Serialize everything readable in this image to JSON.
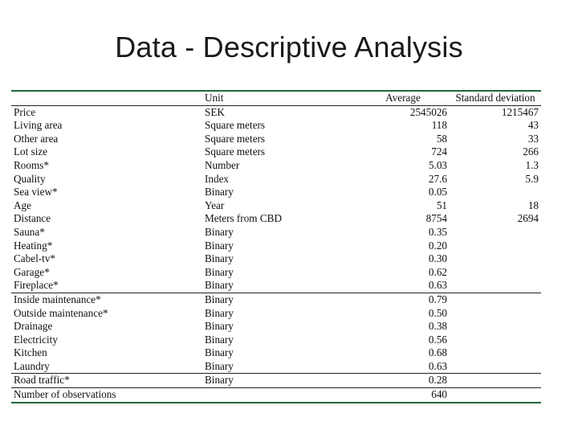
{
  "slide": {
    "title": "Data - Descriptive Analysis",
    "accent_color": "#1f6b3a",
    "text_color": "#111111"
  },
  "table": {
    "headers": {
      "variable": "",
      "unit": "Unit",
      "average": "Average",
      "std": "Standard deviation"
    },
    "rows": [
      {
        "variable": "Price",
        "unit": "SEK",
        "average": "2545026",
        "std": "1215467"
      },
      {
        "variable": "Living area",
        "unit": "Square meters",
        "average": "118",
        "std": "43"
      },
      {
        "variable": "Other area",
        "unit": "Square meters",
        "average": "58",
        "std": "33"
      },
      {
        "variable": "Lot size",
        "unit": "Square meters",
        "average": "724",
        "std": "266"
      },
      {
        "variable": "Rooms*",
        "unit": "Number",
        "average": "5.03",
        "std": "1.3"
      },
      {
        "variable": "Quality",
        "unit": "Index",
        "average": "27.6",
        "std": "5.9"
      },
      {
        "variable": "Sea view*",
        "unit": "Binary",
        "average": "0.05",
        "std": ""
      },
      {
        "variable": "Age",
        "unit": "Year",
        "average": "51",
        "std": "18"
      },
      {
        "variable": "Distance",
        "unit": "Meters from CBD",
        "average": "8754",
        "std": "2694"
      },
      {
        "variable": "Sauna*",
        "unit": "Binary",
        "average": "0.35",
        "std": ""
      },
      {
        "variable": "Heating*",
        "unit": "Binary",
        "average": "0.20",
        "std": ""
      },
      {
        "variable": "Cabel-tv*",
        "unit": "Binary",
        "average": "0.30",
        "std": ""
      },
      {
        "variable": "Garage*",
        "unit": "Binary",
        "average": "0.62",
        "std": ""
      },
      {
        "variable": "Fireplace*",
        "unit": "Binary",
        "average": "0.63",
        "std": ""
      },
      {
        "variable": "Inside maintenance*",
        "unit": "Binary",
        "average": "0.79",
        "std": ""
      },
      {
        "variable": "Outside maintenance*",
        "unit": "Binary",
        "average": "0.50",
        "std": ""
      },
      {
        "variable": "Drainage",
        "unit": "Binary",
        "average": "0.38",
        "std": ""
      },
      {
        "variable": "Electricity",
        "unit": "Binary",
        "average": "0.56",
        "std": ""
      },
      {
        "variable": "Kitchen",
        "unit": "Binary",
        "average": "0.68",
        "std": ""
      },
      {
        "variable": "Laundry",
        "unit": "Binary",
        "average": "0.63",
        "std": ""
      },
      {
        "variable": "Road traffic*",
        "unit": "Binary",
        "average": "0.28",
        "std": ""
      },
      {
        "variable": "Number of observations",
        "unit": "",
        "average": "640",
        "std": ""
      }
    ]
  }
}
